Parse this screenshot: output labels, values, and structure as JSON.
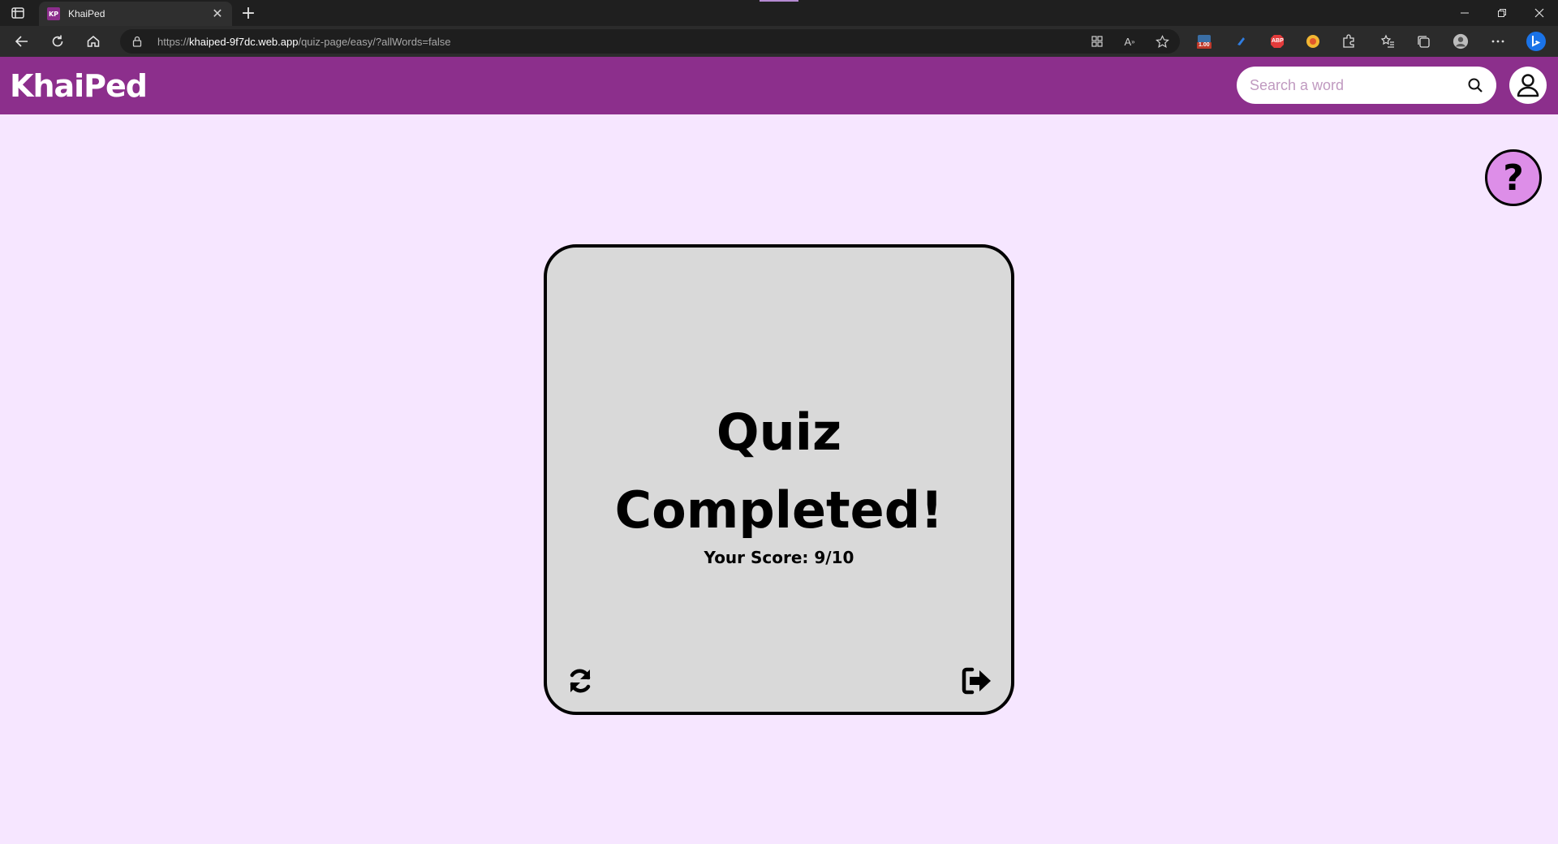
{
  "browser": {
    "tab_title": "KhaiPed",
    "tab_favicon_text": "KP",
    "url_scheme": "https://",
    "url_host": "khaiped-9f7dc.web.app",
    "url_path": "/quiz-page/easy/?allWords=false",
    "extension_badge": "1.00",
    "extension_abp": "ABP"
  },
  "header": {
    "logo": "KhaiPed",
    "search_placeholder": "Search a word"
  },
  "help": {
    "label": "?"
  },
  "quiz": {
    "title": "Quiz Completed!",
    "score_text": "Your Score: 9/10"
  },
  "colors": {
    "header_bg": "#8c2f8c",
    "page_bg": "#f6e6ff",
    "card_bg": "#d9d9d9",
    "help_bg": "#dd8ee8"
  }
}
